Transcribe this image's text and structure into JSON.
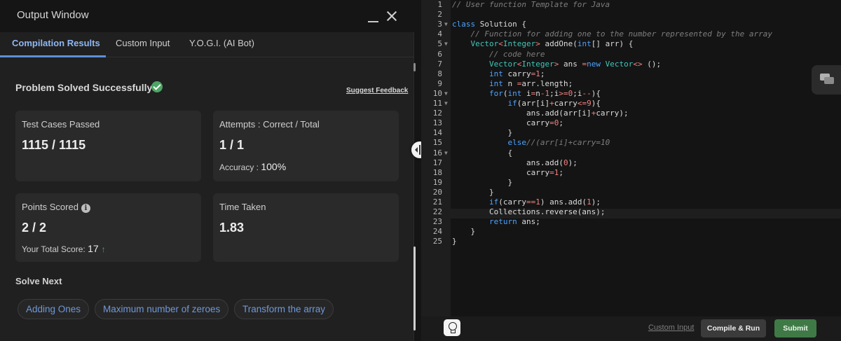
{
  "output_window": {
    "title": "Output Window",
    "tabs": [
      {
        "label": "Compilation Results"
      },
      {
        "label": "Custom Input"
      },
      {
        "label": "Y.O.G.I. (AI Bot)"
      }
    ],
    "status": "Problem Solved Successfully",
    "feedback_link": "Suggest Feedback",
    "cards": {
      "test_cases": {
        "label": "Test Cases Passed",
        "value": "1115 / 1115"
      },
      "attempts": {
        "label": "Attempts : Correct / Total",
        "value": "1 / 1",
        "accuracy_label": "Accuracy :",
        "accuracy_value": "100%"
      },
      "points": {
        "label": "Points Scored",
        "value": "2 / 2",
        "total_label": "Your Total Score:",
        "total_value": "17"
      },
      "time": {
        "label": "Time Taken",
        "value": "1.83"
      }
    },
    "solve_next": {
      "title": "Solve Next",
      "items": [
        "Adding Ones",
        "Maximum number of zeroes",
        "Transform the array"
      ]
    }
  },
  "editor": {
    "code_lines": [
      "// User function Template for Java",
      "",
      "class Solution {",
      "    // Function for adding one to the number represented by the array",
      "    Vector<Integer> addOne(int[] arr) {",
      "        // code here",
      "        Vector<Integer> ans =new Vector<> ();",
      "        int carry=1;",
      "        int n =arr.length;",
      "        for(int i=n-1;i>=0;i--){",
      "            if(arr[i]+carry<=9){",
      "                ans.add(arr[i]+carry);",
      "                carry=0;",
      "            }",
      "            else//(arr[i]+carry=10",
      "            {",
      "                ans.add(0);",
      "                carry=1;",
      "            }",
      "        }",
      "        if(carry==1) ans.add(1);",
      "        Collections.reverse(ans);",
      "        return ans;",
      "    }",
      "}"
    ],
    "fold_lines": [
      3,
      5,
      10,
      11,
      16
    ]
  },
  "footer": {
    "custom_input_link": "Custom Input",
    "compile_button": "Compile & Run",
    "submit_button": "Submit"
  },
  "colors": {
    "keyword": "#4da3ff",
    "type": "#3fc6b9",
    "comment": "#7e7e7e",
    "number": "#f08080",
    "operator": "#f08080",
    "accent": "#5e8fd8",
    "success": "#4da564"
  }
}
